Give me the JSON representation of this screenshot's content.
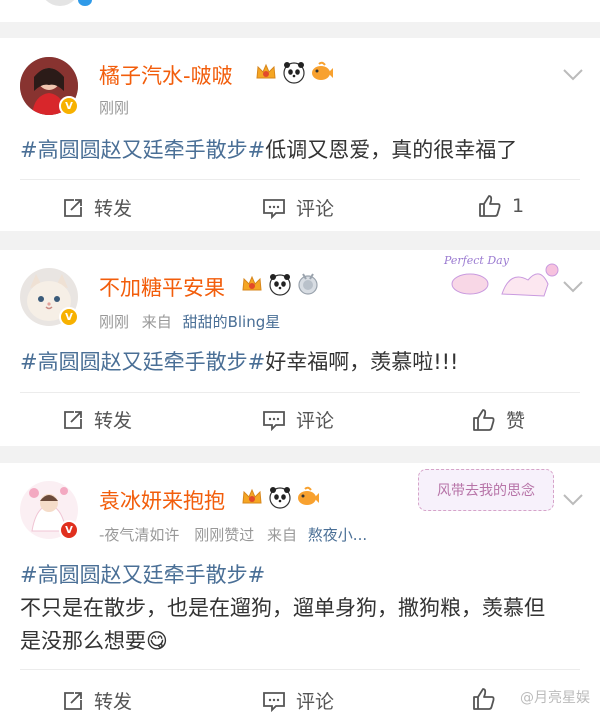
{
  "posts": [
    {
      "username": "橘子汽水-啵啵",
      "meta_time": "刚刚",
      "meta_source_prefix": "",
      "meta_source": "",
      "hashtag": "#高圆圆赵又廷牵手散步#",
      "text": "低调又恩爱，真的很幸福了",
      "text2": "",
      "actions": {
        "repost": "转发",
        "comment": "评论",
        "like": "1"
      },
      "badge_icons": [
        "crown-icon",
        "panda-icon",
        "fish-icon"
      ]
    },
    {
      "username": "不加糖平安果",
      "meta_time": "刚刚",
      "meta_source_prefix": "来自",
      "meta_source": "甜甜的Bling星",
      "hashtag": "#高圆圆赵又廷牵手散步#",
      "text": "好幸福啊，羡慕啦!!!",
      "text2": "",
      "actions": {
        "repost": "转发",
        "comment": "评论",
        "like": "赞"
      },
      "decor_text": "Perfect Day",
      "badge_icons": [
        "crown-icon",
        "panda-icon",
        "medal-icon"
      ]
    },
    {
      "username": "袁冰妍来抱抱",
      "meta_time": "-夜气清如许",
      "meta_liked": "刚刚赞过",
      "meta_source_prefix": "来自",
      "meta_source": "熬夜小...",
      "hashtag": "#高圆圆赵又廷牵手散步#",
      "text": "不只是在散步，也是在遛狗，遛单身狗，撒狗粮，羡慕但",
      "text2": "是没那么想要",
      "emoji": "😋",
      "actions": {
        "repost": "转发",
        "comment": "评论",
        "like": ""
      },
      "decor_text": "风带去我的思念",
      "badge_icons": [
        "crown-icon",
        "panda-icon",
        "fish-icon"
      ]
    }
  ],
  "watermark": "@月亮星娱",
  "colors": {
    "username": "#f25d0b",
    "hashtag": "#4a6f96",
    "verified": "#f7b100",
    "verified_red": "#e0301e"
  }
}
